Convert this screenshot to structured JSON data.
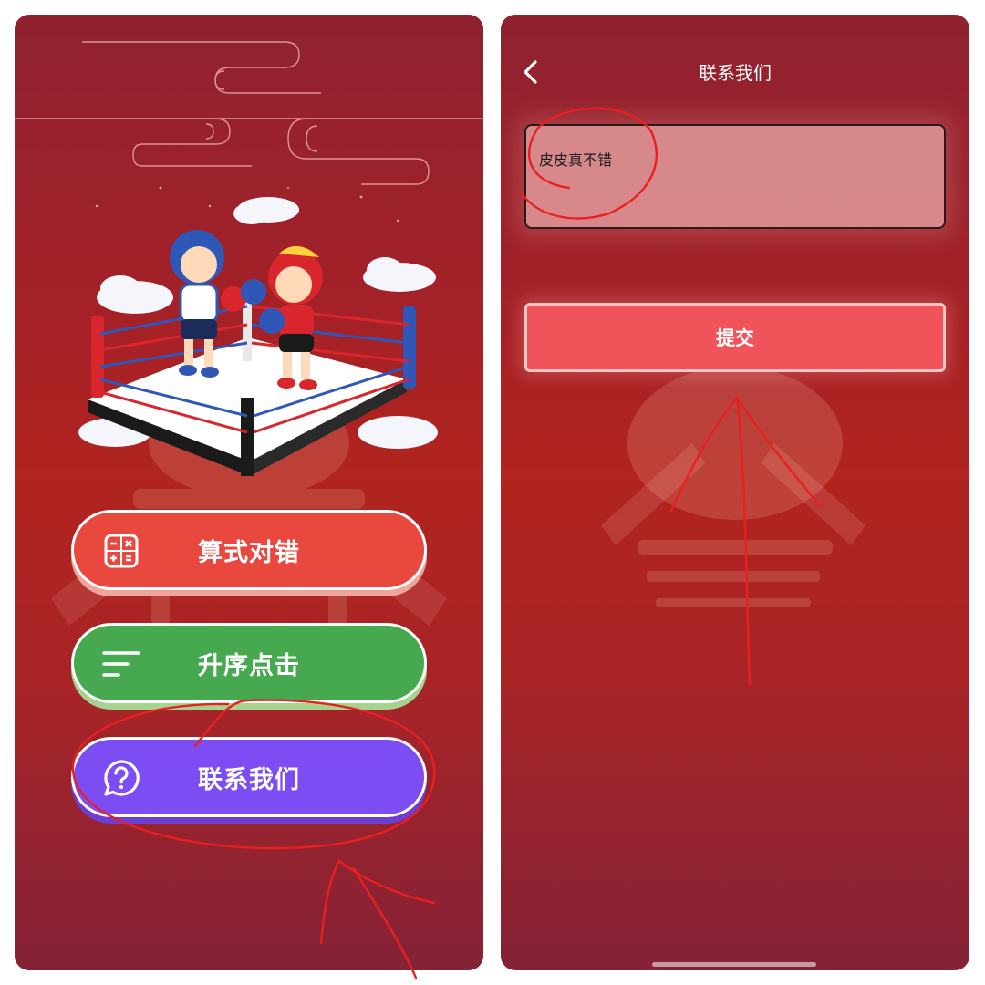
{
  "left_screen": {
    "hero_image": "boxing-ring-kids-illustration",
    "buttons": [
      {
        "label": "算式对错",
        "icon": "calculator-icon",
        "color": "#e8483d"
      },
      {
        "label": "升序点击",
        "icon": "sort-lines-icon",
        "color": "#46a84f"
      },
      {
        "label": "联系我们",
        "icon": "question-bubble-icon",
        "color": "#7b4df2"
      }
    ]
  },
  "right_screen": {
    "nav": {
      "back_icon": "chevron-left-icon",
      "title": "联系我们"
    },
    "message_field": {
      "value": "皮皮真不错"
    },
    "submit_label": "提交"
  },
  "colors": {
    "background_red": "#a52127",
    "submit_button": "#f0545a",
    "annotation_red": "#e82020"
  }
}
